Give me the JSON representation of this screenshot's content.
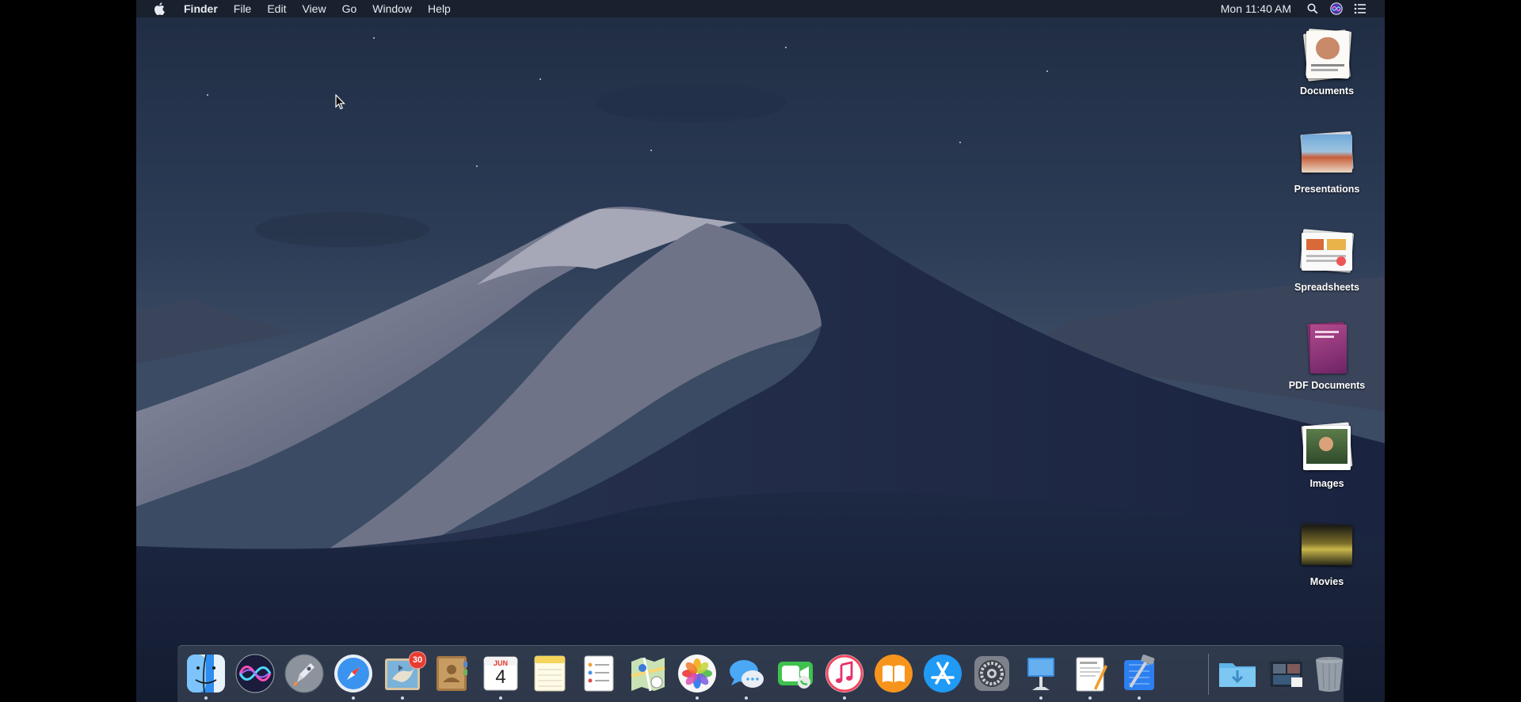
{
  "menubar": {
    "apple_icon": "apple-icon",
    "app_name": "Finder",
    "items": [
      "File",
      "Edit",
      "View",
      "Go",
      "Window",
      "Help"
    ],
    "clock": "Mon 11:40 AM",
    "right_icons": [
      "spotlight-search-icon",
      "siri-icon",
      "notification-center-icon"
    ]
  },
  "desktop": {
    "stacks": [
      {
        "label": "Documents",
        "icon": "documents-stack-icon"
      },
      {
        "label": "Presentations",
        "icon": "presentations-stack-icon"
      },
      {
        "label": "Spreadsheets",
        "icon": "spreadsheets-stack-icon"
      },
      {
        "label": "PDF Documents",
        "icon": "pdf-documents-stack-icon"
      },
      {
        "label": "Images",
        "icon": "images-stack-icon"
      },
      {
        "label": "Movies",
        "icon": "movies-stack-icon"
      }
    ]
  },
  "dock": {
    "apps": [
      {
        "name": "finder",
        "running": true
      },
      {
        "name": "siri",
        "running": false
      },
      {
        "name": "launchpad",
        "running": false
      },
      {
        "name": "safari",
        "running": true
      },
      {
        "name": "mail",
        "running": true,
        "badge": "30"
      },
      {
        "name": "contacts",
        "running": false
      },
      {
        "name": "calendar",
        "running": true,
        "month": "JUN",
        "day": "4"
      },
      {
        "name": "notes",
        "running": false
      },
      {
        "name": "reminders",
        "running": false
      },
      {
        "name": "maps",
        "running": false
      },
      {
        "name": "photos",
        "running": true
      },
      {
        "name": "messages",
        "running": true
      },
      {
        "name": "facetime",
        "running": false
      },
      {
        "name": "itunes",
        "running": true
      },
      {
        "name": "books",
        "running": false
      },
      {
        "name": "app-store",
        "running": false
      },
      {
        "name": "system-preferences",
        "running": false
      },
      {
        "name": "keynote",
        "running": true
      },
      {
        "name": "pages",
        "running": true
      },
      {
        "name": "xcode",
        "running": true
      },
      {
        "name": "downloads",
        "running": false
      },
      {
        "name": "documents-stack",
        "running": false
      },
      {
        "name": "trash",
        "running": false
      }
    ]
  },
  "colors": {
    "menubar_bg": "#181e2a",
    "dock_bg": "#465060",
    "badge_red": "#e93b30",
    "dune_light": "#8f94a6",
    "dune_dark": "#1d2842"
  }
}
